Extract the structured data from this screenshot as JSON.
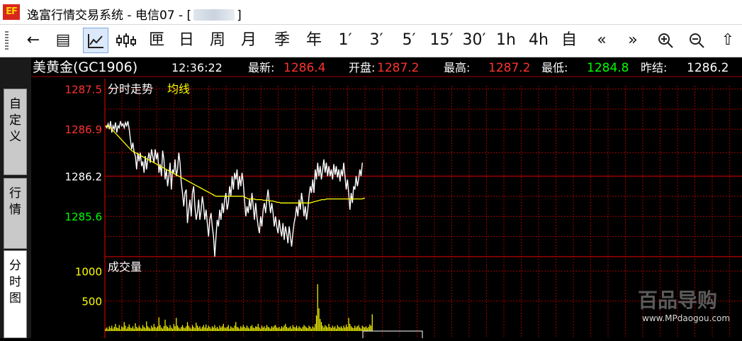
{
  "window": {
    "title_prefix": "逸富行情交易系统 - 电信07 - [",
    "title_suffix": "]",
    "logo_text": "EF"
  },
  "toolbar": {
    "buttons": [
      {
        "name": "back-button",
        "label": "←"
      },
      {
        "name": "list-view-button",
        "label": "▤"
      },
      {
        "name": "timeshare-chart-button",
        "label": "",
        "icon": "line-chart-icon",
        "active": true
      },
      {
        "name": "candle-chart-button",
        "label": "",
        "icon": "candlestick-icon"
      },
      {
        "name": "indicator-button",
        "label": "匣"
      },
      {
        "name": "period-day-button",
        "label": "日"
      },
      {
        "name": "period-week-button",
        "label": "周"
      },
      {
        "name": "period-month-button",
        "label": "月"
      },
      {
        "name": "period-season-button",
        "label": "季"
      },
      {
        "name": "period-year-button",
        "label": "年"
      },
      {
        "name": "period-1min-button",
        "label": "1′"
      },
      {
        "name": "period-3min-button",
        "label": "3′"
      },
      {
        "name": "period-5min-button",
        "label": "5′"
      },
      {
        "name": "period-15min-button",
        "label": "15′"
      },
      {
        "name": "period-30min-button",
        "label": "30′"
      },
      {
        "name": "period-1h-button",
        "label": "1h"
      },
      {
        "name": "period-4h-button",
        "label": "4h"
      },
      {
        "name": "custom-period-button",
        "label": "自"
      },
      {
        "name": "scroll-left-button",
        "label": "«"
      },
      {
        "name": "scroll-right-button",
        "label": "»"
      },
      {
        "name": "zoom-in-button",
        "label": "",
        "icon": "zoom-in-icon"
      },
      {
        "name": "zoom-out-button",
        "label": "",
        "icon": "zoom-out-icon"
      },
      {
        "name": "up-button",
        "label": "⇧"
      }
    ]
  },
  "side_tabs": [
    {
      "name": "tab-custom",
      "label": "自定义",
      "active": false
    },
    {
      "name": "tab-quotes",
      "label": "行情",
      "active": false
    },
    {
      "name": "tab-timeshare",
      "label": "分时图",
      "active": true
    }
  ],
  "quote": {
    "symbol": "美黄金(GC1906)",
    "time": "12:36:22",
    "last_label": "最新:",
    "last": "1286.4",
    "open_label": "开盘:",
    "open": "1287.2",
    "high_label": "最高:",
    "high": "1287.2",
    "low_label": "最低:",
    "low": "1284.8",
    "prev_label": "昨结:",
    "prev": "1286.2"
  },
  "colors": {
    "up": "#ff3232",
    "down": "#00ff00",
    "price_line": "#ffffff",
    "avg_line": "#ffff00",
    "grid": "#a00000",
    "volume": "#ffff00"
  },
  "chart_data": {
    "type": "line",
    "title": "分时走势",
    "avg_label": "均线",
    "y_ticks": [
      "1287.5",
      "1286.9",
      "1286.2",
      "1285.6"
    ],
    "ylim": [
      1285.0,
      1287.6
    ],
    "reference": 1286.2,
    "series": [
      {
        "values": [
          1286.95,
          1286.92,
          1286.98,
          1286.9,
          1287.02,
          1286.85,
          1286.95,
          1286.9,
          1287.0,
          1286.85,
          1286.95,
          1286.92,
          1287.02,
          1286.95,
          1286.98,
          1286.92,
          1287.0,
          1286.95,
          1287.02,
          1286.9,
          1286.75,
          1286.6,
          1286.7,
          1286.55,
          1286.5,
          1286.3,
          1286.55,
          1286.42,
          1286.55,
          1286.35,
          1286.42,
          1286.25,
          1286.5,
          1286.3,
          1286.45,
          1286.55,
          1286.4,
          1286.6,
          1286.5,
          1286.4,
          1286.6,
          1286.45,
          1286.55,
          1286.25,
          1286.38,
          1286.2,
          1286.58,
          1286.45,
          1286.15,
          1286.3,
          1286.05,
          1286.2,
          1286.4,
          1286.0,
          1286.3,
          1286.25,
          1286.45,
          1286.2,
          1286.3,
          1286.55,
          1286.4,
          1286.1,
          1285.95,
          1285.75,
          1285.95,
          1286.0,
          1285.5,
          1285.7,
          1285.85,
          1285.6,
          1285.95,
          1286.05,
          1285.75,
          1285.55,
          1285.65,
          1285.85,
          1285.55,
          1285.7,
          1285.9,
          1285.75,
          1285.55,
          1285.7,
          1285.5,
          1285.3,
          1285.55,
          1285.65,
          1285.45,
          1285.3,
          1285.0,
          1285.3,
          1285.55,
          1285.45,
          1285.7,
          1285.55,
          1285.8,
          1285.65,
          1285.85,
          1285.95,
          1285.7,
          1285.8,
          1286.05,
          1285.9,
          1286.2,
          1286.0,
          1286.25,
          1286.15,
          1286.3,
          1286.0,
          1286.2,
          1286.05,
          1286.25,
          1286.1,
          1285.85,
          1285.6,
          1285.75,
          1285.65,
          1285.85,
          1285.7,
          1285.95,
          1285.75,
          1285.55,
          1285.8,
          1285.6,
          1285.45,
          1285.35,
          1285.6,
          1285.45,
          1285.7,
          1285.8,
          1285.65,
          1285.85,
          1286.0,
          1285.8,
          1285.65,
          1285.8,
          1285.65,
          1285.45,
          1285.6,
          1285.45,
          1285.35,
          1285.55,
          1285.4,
          1285.3,
          1285.5,
          1285.25,
          1285.45,
          1285.35,
          1285.2,
          1285.45,
          1285.3,
          1285.15,
          1285.35,
          1285.5,
          1285.6,
          1285.75,
          1285.6,
          1285.85,
          1285.7,
          1285.95,
          1285.8,
          1285.6,
          1285.75,
          1285.55,
          1285.7,
          1285.9,
          1286.05,
          1285.95,
          1286.15,
          1285.95,
          1286.3,
          1286.15,
          1286.4,
          1286.2,
          1286.35,
          1286.15,
          1286.3,
          1286.45,
          1286.25,
          1286.4,
          1286.2,
          1286.35,
          1286.2,
          1286.3,
          1286.15,
          1286.38,
          1286.22,
          1286.35,
          1286.18,
          1286.3,
          1286.12,
          1286.3,
          1286.2,
          1286.4,
          1286.2,
          1286.0,
          1286.15,
          1285.95,
          1285.7,
          1285.95,
          1285.8,
          1286.05,
          1286.0,
          1286.2,
          1286.05,
          1286.15,
          1286.3,
          1286.2,
          1286.4
        ]
      },
      {
        "values": [
          1286.95,
          1286.95,
          1286.94,
          1286.93,
          1286.92,
          1286.9,
          1286.88,
          1286.86,
          1286.84,
          1286.82,
          1286.8,
          1286.78,
          1286.76,
          1286.74,
          1286.72,
          1286.7,
          1286.68,
          1286.66,
          1286.64,
          1286.62,
          1286.6,
          1286.58,
          1286.57,
          1286.56,
          1286.55,
          1286.54,
          1286.53,
          1286.52,
          1286.51,
          1286.5,
          1286.49,
          1286.48,
          1286.47,
          1286.46,
          1286.45,
          1286.44,
          1286.43,
          1286.42,
          1286.41,
          1286.4,
          1286.39,
          1286.38,
          1286.37,
          1286.36,
          1286.35,
          1286.34,
          1286.33,
          1286.32,
          1286.31,
          1286.3,
          1286.29,
          1286.28,
          1286.27,
          1286.26,
          1286.25,
          1286.24,
          1286.23,
          1286.22,
          1286.21,
          1286.2,
          1286.19,
          1286.18,
          1286.17,
          1286.16,
          1286.15,
          1286.14,
          1286.13,
          1286.12,
          1286.11,
          1286.1,
          1286.09,
          1286.08,
          1286.07,
          1286.06,
          1286.05,
          1286.04,
          1286.03,
          1286.02,
          1286.01,
          1286.0,
          1285.99,
          1285.98,
          1285.97,
          1285.96,
          1285.95,
          1285.94,
          1285.93,
          1285.92,
          1285.91,
          1285.9,
          1285.9,
          1285.9,
          1285.9,
          1285.9,
          1285.9,
          1285.9,
          1285.9,
          1285.9,
          1285.9,
          1285.9,
          1285.9,
          1285.9,
          1285.9,
          1285.9,
          1285.9,
          1285.9,
          1285.9,
          1285.9,
          1285.9,
          1285.9,
          1285.9,
          1285.9,
          1285.89,
          1285.88,
          1285.87,
          1285.86,
          1285.86,
          1285.86,
          1285.86,
          1285.86,
          1285.86,
          1285.85,
          1285.85,
          1285.85,
          1285.85,
          1285.85,
          1285.85,
          1285.84,
          1285.84,
          1285.84,
          1285.84,
          1285.84,
          1285.83,
          1285.83,
          1285.83,
          1285.83,
          1285.82,
          1285.82,
          1285.81,
          1285.81,
          1285.81,
          1285.8,
          1285.8,
          1285.8,
          1285.8,
          1285.8,
          1285.8,
          1285.8,
          1285.8,
          1285.8,
          1285.8,
          1285.8,
          1285.8,
          1285.8,
          1285.8,
          1285.8,
          1285.8,
          1285.8,
          1285.8,
          1285.8,
          1285.8,
          1285.8,
          1285.8,
          1285.8,
          1285.8,
          1285.8,
          1285.81,
          1285.81,
          1285.82,
          1285.82,
          1285.83,
          1285.83,
          1285.84,
          1285.84,
          1285.85,
          1285.85,
          1285.85,
          1285.85,
          1285.86,
          1285.86,
          1285.86,
          1285.86,
          1285.86,
          1285.86,
          1285.86,
          1285.86,
          1285.86,
          1285.86,
          1285.86,
          1285.86,
          1285.86,
          1285.86,
          1285.86,
          1285.86,
          1285.86,
          1285.86,
          1285.86,
          1285.86,
          1285.86,
          1285.86,
          1285.86,
          1285.86,
          1285.86,
          1285.86,
          1285.86,
          1285.86,
          1285.86,
          1285.86,
          1285.87,
          1285.87
        ]
      }
    ],
    "volume": {
      "title": "成交量",
      "y_ticks": [
        "1000",
        "500"
      ],
      "ylim": [
        0,
        1180
      ],
      "values": [
        40,
        60,
        30,
        80,
        50,
        90,
        40,
        70,
        120,
        60,
        50,
        100,
        30,
        80,
        60,
        150,
        90,
        40,
        70,
        110,
        60,
        50,
        80,
        40,
        130,
        70,
        50,
        90,
        60,
        40,
        100,
        70,
        50,
        160,
        80,
        60,
        40,
        90,
        60,
        120,
        70,
        50,
        80,
        230,
        100,
        60,
        40,
        80,
        190,
        90,
        70,
        50,
        100,
        60,
        40,
        120,
        80,
        220,
        90,
        60,
        40,
        70,
        100,
        60,
        50,
        80,
        150,
        90,
        60,
        40,
        100,
        70,
        50,
        140,
        90,
        60,
        80,
        40,
        70,
        100,
        60,
        110,
        50,
        90,
        70,
        40,
        80,
        60,
        100,
        50,
        70,
        40,
        90,
        60,
        80,
        120,
        60,
        50,
        70,
        100,
        40,
        80,
        60,
        50,
        90,
        150,
        70,
        60,
        40,
        80,
        60,
        100,
        70,
        50,
        90,
        60,
        40,
        80,
        100,
        60,
        50,
        80,
        70,
        120,
        60,
        40,
        90,
        60,
        80,
        50,
        100,
        70,
        60,
        40,
        80,
        60,
        90,
        100,
        60,
        50,
        70,
        40,
        80,
        60,
        90,
        120,
        70,
        50,
        60,
        80,
        40,
        100,
        70,
        60,
        90,
        50,
        80,
        60,
        40,
        70,
        100,
        80,
        60,
        50,
        90,
        70,
        40,
        80,
        60,
        120,
        260,
        780,
        380,
        200,
        150,
        90,
        60,
        100,
        80,
        60,
        120,
        70,
        50,
        90,
        60,
        80,
        40,
        100,
        70,
        60,
        80,
        50,
        90,
        60,
        110,
        70,
        220,
        120,
        80,
        60,
        50,
        90,
        60,
        80,
        100,
        60,
        40,
        90,
        70,
        60,
        80,
        50,
        70,
        110,
        90,
        280
      ]
    }
  },
  "watermark": {
    "brand": "百品导购",
    "url": "www.MPdaogou.com"
  }
}
